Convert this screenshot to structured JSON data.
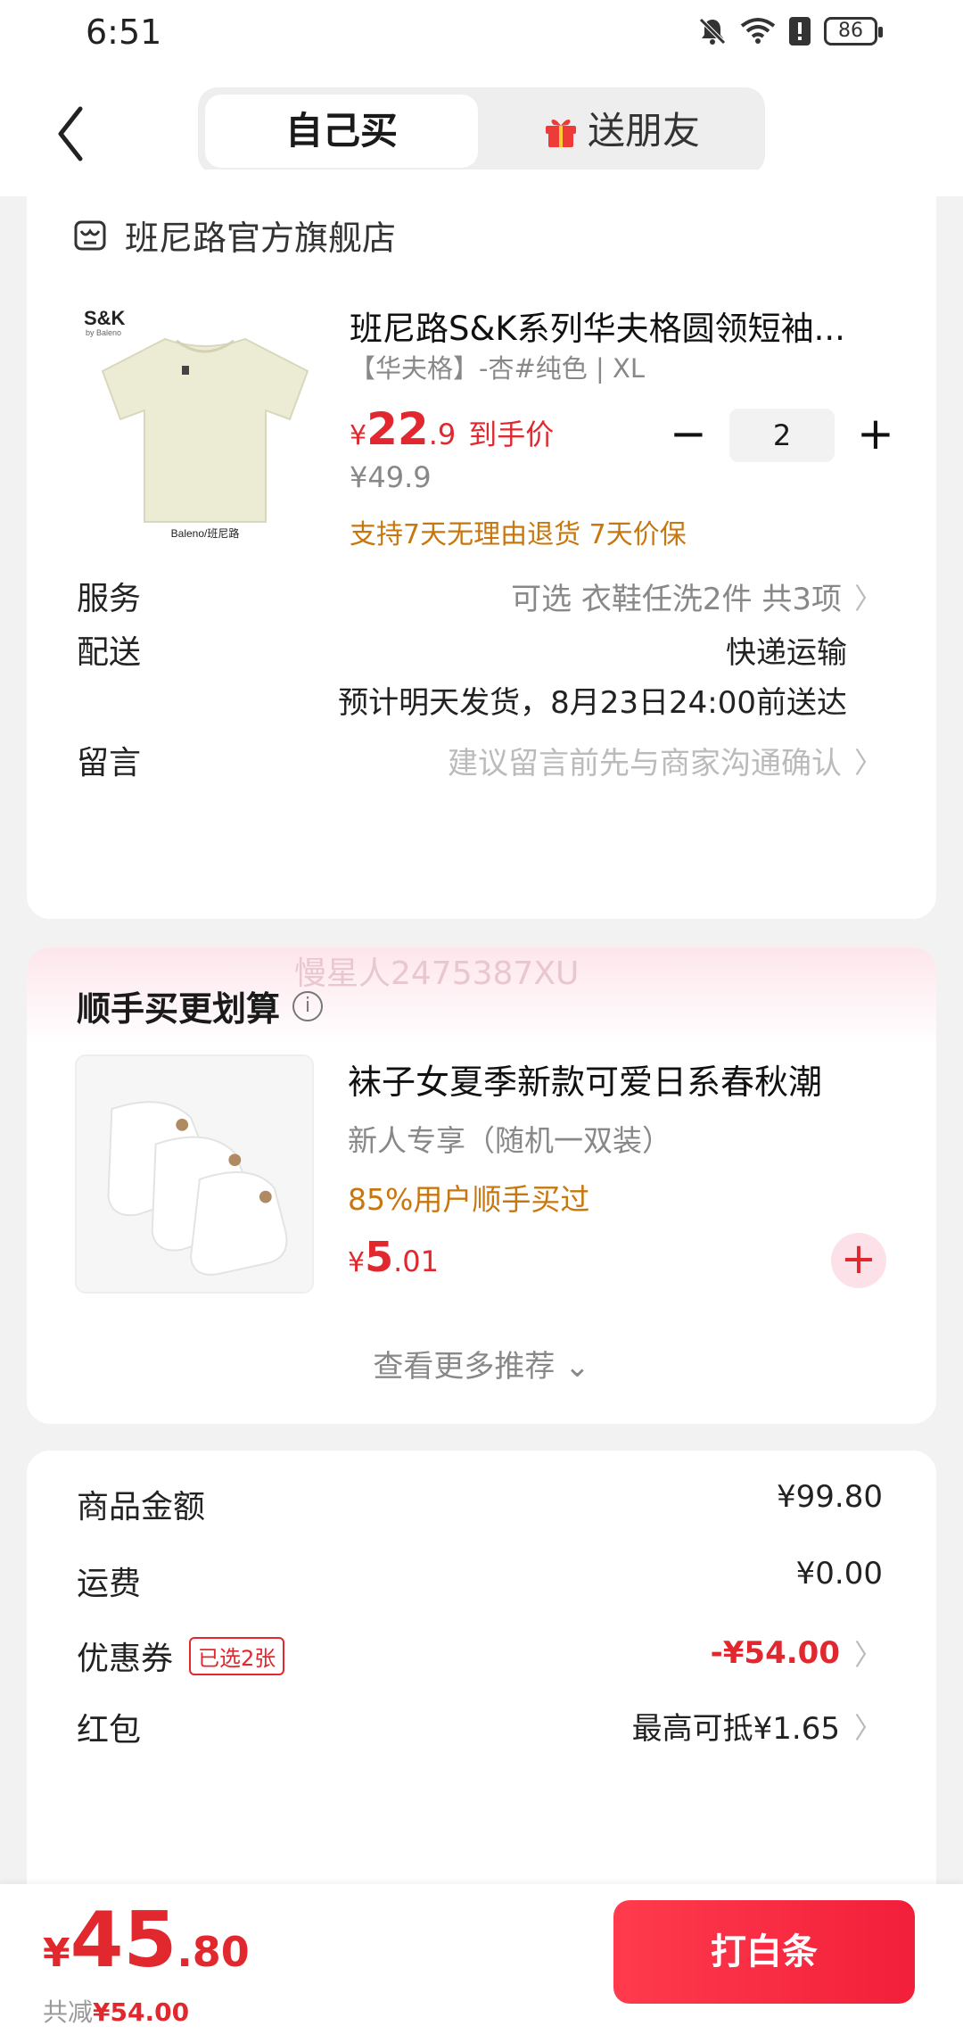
{
  "status_bar": {
    "time": "6:51",
    "battery": "86"
  },
  "header": {
    "tab_self": "自己买",
    "tab_gift": "送朋友"
  },
  "order": {
    "shop_name": "班尼路官方旗舰店",
    "product": {
      "image_brand": "S&K",
      "image_brand_sub": "by Baleno",
      "image_logo": "Baleno/班尼路",
      "title": "班尼路S&K系列华夫格圆领短袖...",
      "sku": "【华夫格】-杏#纯色 | XL",
      "price_symbol": "¥",
      "price_int": "22",
      "price_dec": ".9",
      "price_tag": "到手价",
      "original_price": "¥49.9",
      "promise": "支持7天无理由退货  7天价保",
      "quantity": "2"
    },
    "service": {
      "label": "服务",
      "value": "可选  衣鞋任洗2件  共3项"
    },
    "delivery": {
      "label": "配送",
      "method": "快递运输",
      "estimate": "预计明天发货，8月23日24:00前送达"
    },
    "message": {
      "label": "留言",
      "placeholder": "建议留言前先与商家沟通确认"
    }
  },
  "addon": {
    "watermark": "慢星人2475387XU",
    "title": "顺手买更划算",
    "info_icon": "i",
    "item": {
      "title": "袜子女夏季新款可爱日系春秋潮",
      "subtitle": "新人专享（随机一双装）",
      "bought": "85%用户顺手买过",
      "price_symbol": "¥",
      "price_int": "5",
      "price_dec": ".01"
    },
    "more": "查看更多推荐"
  },
  "summary": {
    "goods_label": "商品金额",
    "goods_value": "¥99.80",
    "shipping_label": "运费",
    "shipping_value": "¥0.00",
    "coupon_label": "优惠券",
    "coupon_badge": "已选2张",
    "coupon_value": "-¥54.00",
    "redpacket_label": "红包",
    "redpacket_value": "最高可抵¥1.65"
  },
  "bottom": {
    "total_symbol": "¥",
    "total_int": "45",
    "total_dec": ".80",
    "saved_label": "共减",
    "saved_value": "¥54.00",
    "pay_button": "打白条"
  },
  "colors": {
    "accent": "#e0282e",
    "promise": "#c8760e",
    "button_start": "#ff3b4d",
    "button_end": "#f21f3a"
  },
  "icons": [
    "back-arrow-icon",
    "gift-icon",
    "shop-icon",
    "chevron-right-icon",
    "info-icon",
    "plus-icon",
    "minus-icon",
    "chevron-down-icon",
    "bell-off-icon",
    "wifi-icon",
    "battery-icon"
  ]
}
